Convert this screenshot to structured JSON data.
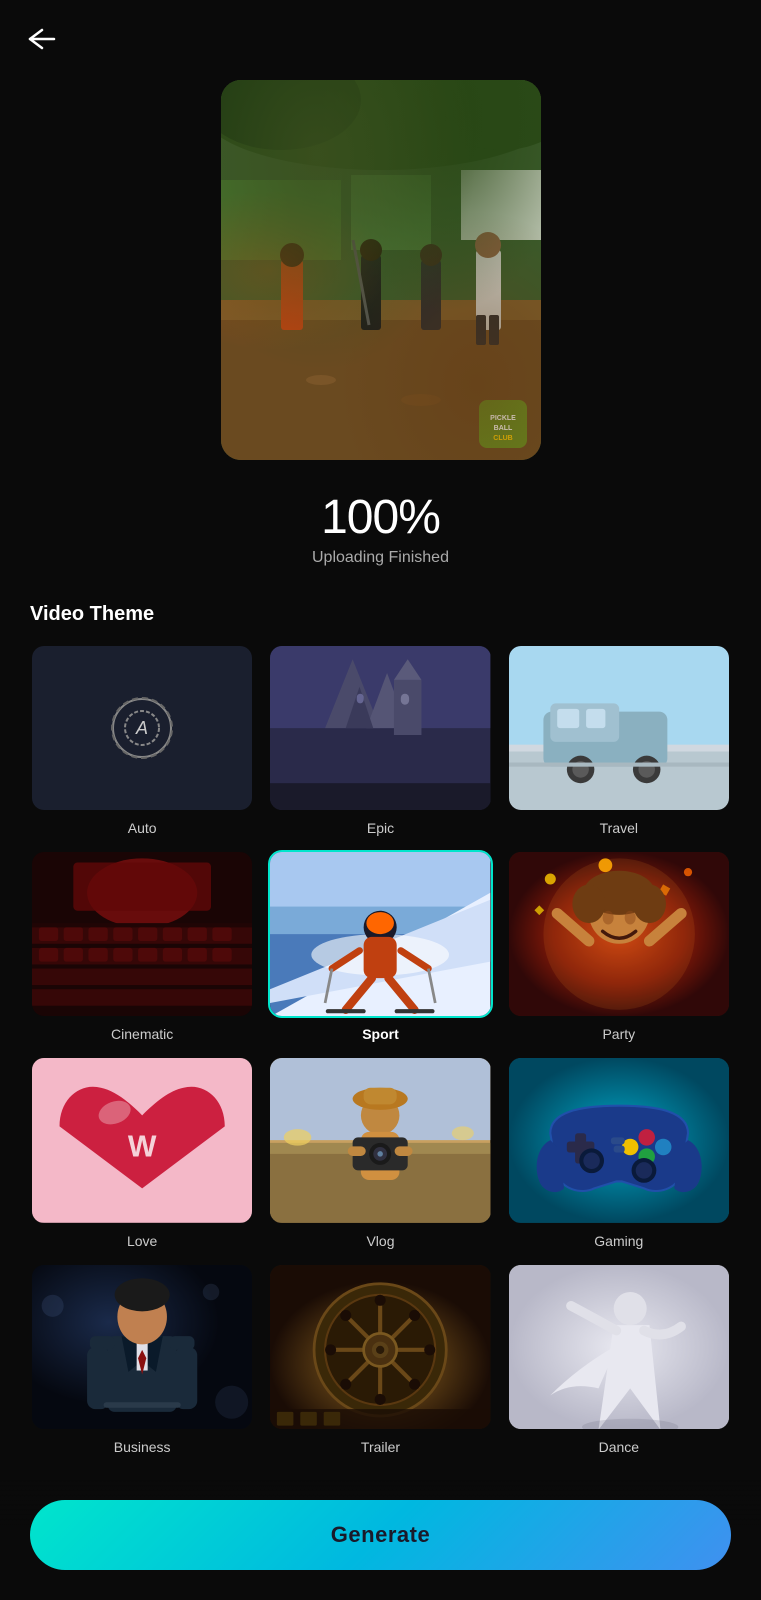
{
  "header": {
    "back_button_symbol": "←"
  },
  "upload": {
    "progress_percent": "100%",
    "status_label": "Uploading Finished"
  },
  "section": {
    "video_theme_title": "Video Theme"
  },
  "themes": [
    {
      "id": "auto",
      "label": "Auto",
      "selected": false
    },
    {
      "id": "epic",
      "label": "Epic",
      "selected": false
    },
    {
      "id": "travel",
      "label": "Travel",
      "selected": false
    },
    {
      "id": "cinematic",
      "label": "Cinematic",
      "selected": false
    },
    {
      "id": "sport",
      "label": "Sport",
      "selected": true
    },
    {
      "id": "party",
      "label": "Party",
      "selected": false
    },
    {
      "id": "love",
      "label": "Love",
      "selected": false
    },
    {
      "id": "vlog",
      "label": "Vlog",
      "selected": false
    },
    {
      "id": "gaming",
      "label": "Gaming",
      "selected": false
    },
    {
      "id": "business",
      "label": "Business",
      "selected": false
    },
    {
      "id": "trailer",
      "label": "Trailer",
      "selected": false
    },
    {
      "id": "dance",
      "label": "Dance",
      "selected": false
    }
  ],
  "generate_button": {
    "label": "Generate"
  }
}
